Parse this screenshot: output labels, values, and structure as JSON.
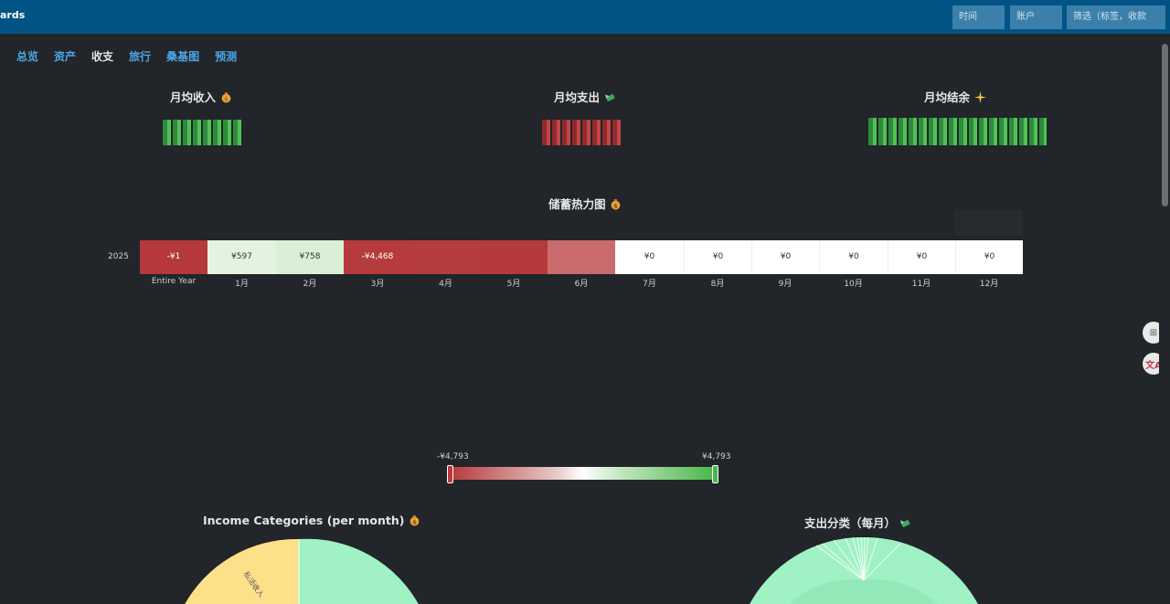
{
  "header": {
    "title": "ards",
    "time_placeholder": "时间",
    "account_placeholder": "账户",
    "filter_placeholder": "筛选（标签，收款"
  },
  "nav": {
    "tabs": [
      "总览",
      "资产",
      "收支",
      "旅行",
      "桑基图",
      "预测"
    ],
    "active": "收支"
  },
  "stats": {
    "income": {
      "label": "月均收入",
      "icon": "money-bag-icon",
      "value": ""
    },
    "expense": {
      "label": "月均支出",
      "icon": "money-wings-icon",
      "value": ""
    },
    "balance": {
      "label": "月均结余",
      "icon": "sparkles-icon",
      "value": ""
    }
  },
  "heatmap": {
    "title": "储蓄热力图",
    "icon": "money-bag-icon",
    "year": "2025",
    "cells": [
      "-¥1",
      "¥597",
      "¥758",
      "-¥4,468",
      "",
      "",
      "",
      "¥0",
      "¥0",
      "¥0",
      "¥0",
      "¥0",
      "¥0"
    ],
    "months": [
      "Entire Year",
      "1月",
      "2月",
      "3月",
      "4月",
      "5月",
      "6月",
      "7月",
      "8月",
      "9月",
      "10月",
      "11月",
      "12月"
    ],
    "legend_min": "-¥4,793",
    "legend_max": "¥4,793"
  },
  "charts": {
    "income_title": "Income Categories (per month)",
    "income_slice_label": "私活收入",
    "expense_title": "支出分类（每月）"
  },
  "side": {
    "qr_label": "⊞",
    "translate_label": "文A"
  },
  "colors": {
    "topbar": "#025385",
    "income": "#4bb649",
    "expense": "#b7393a"
  }
}
